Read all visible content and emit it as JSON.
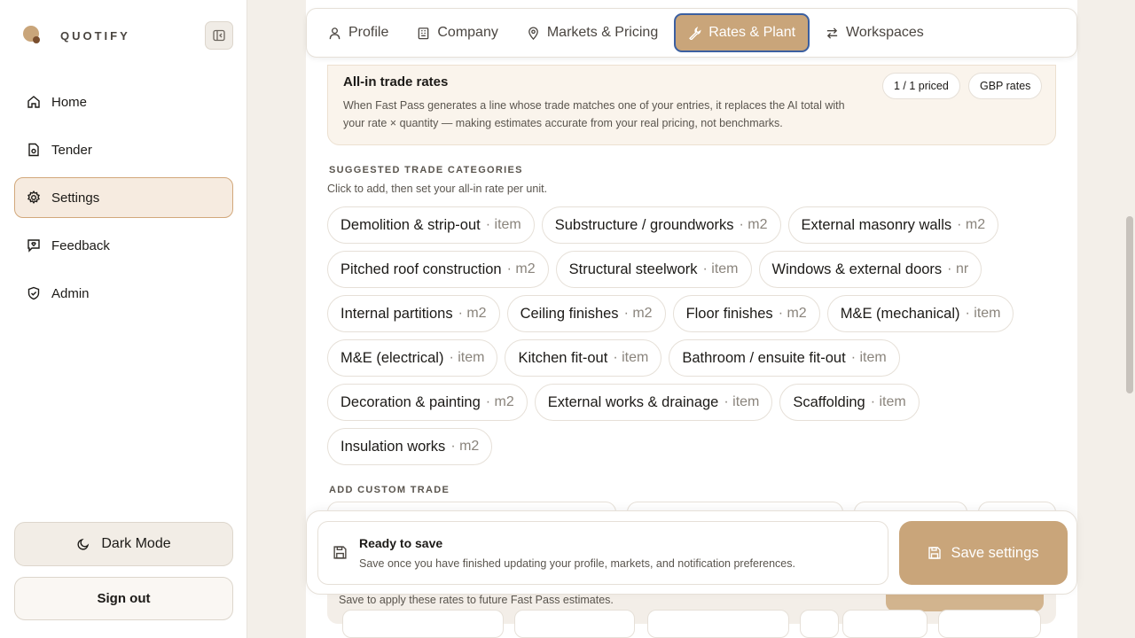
{
  "brand": {
    "name": "QUOTIFY"
  },
  "sidebar": {
    "items": [
      {
        "label": "Home",
        "icon": "home-icon"
      },
      {
        "label": "Tender",
        "icon": "document-icon"
      },
      {
        "label": "Settings",
        "icon": "gear-icon",
        "active": true
      },
      {
        "label": "Feedback",
        "icon": "message-icon"
      },
      {
        "label": "Admin",
        "icon": "shield-icon"
      }
    ],
    "dark_mode_label": "Dark Mode",
    "sign_out_label": "Sign out"
  },
  "tabs": [
    {
      "label": "Profile",
      "icon": "user-icon"
    },
    {
      "label": "Company",
      "icon": "building-icon"
    },
    {
      "label": "Markets & Pricing",
      "icon": "location-pin-icon"
    },
    {
      "label": "Rates & Plant",
      "icon": "wrench-icon",
      "active": true
    },
    {
      "label": "Workspaces",
      "icon": "swap-arrows-icon"
    }
  ],
  "rates": {
    "title": "All-in trade rates",
    "description": "When Fast Pass generates a line whose trade matches one of your entries, it replaces the AI total with your rate × quantity — making estimates accurate from your real pricing, not benchmarks.",
    "priced_badge": "1 / 1 priced",
    "currency_badge": "GBP rates"
  },
  "suggested": {
    "title": "SUGGESTED TRADE CATEGORIES",
    "hint": "Click to add, then set your all-in rate per unit.",
    "chips": [
      {
        "name": "Demolition & strip-out",
        "unit": "· item"
      },
      {
        "name": "Substructure / groundworks",
        "unit": "· m2"
      },
      {
        "name": "External masonry walls",
        "unit": "· m2"
      },
      {
        "name": "Pitched roof construction",
        "unit": "· m2"
      },
      {
        "name": "Structural steelwork",
        "unit": "· item"
      },
      {
        "name": "Windows & external doors",
        "unit": "· nr"
      },
      {
        "name": "Internal partitions",
        "unit": "· m2"
      },
      {
        "name": "Ceiling finishes",
        "unit": "· m2"
      },
      {
        "name": "Floor finishes",
        "unit": "· m2"
      },
      {
        "name": "M&E (mechanical)",
        "unit": "· item"
      },
      {
        "name": "M&E (electrical)",
        "unit": "· item"
      },
      {
        "name": "Kitchen fit-out",
        "unit": "· item"
      },
      {
        "name": "Bathroom / ensuite fit-out",
        "unit": "· item"
      },
      {
        "name": "Decoration & painting",
        "unit": "· m2"
      },
      {
        "name": "External works & drainage",
        "unit": "· item"
      },
      {
        "name": "Scaffolding",
        "unit": "· item"
      },
      {
        "name": "Insulation works",
        "unit": "· m2"
      }
    ]
  },
  "custom": {
    "title": "ADD CUSTOM TRADE",
    "apply_hint": "Save to apply these rates to future Fast Pass estimates."
  },
  "savebar": {
    "title": "Ready to save",
    "description": "Save once you have finished updating your profile, markets, and notification preferences.",
    "button": "Save settings"
  },
  "colors": {
    "accent": "#c9a57a",
    "focus_ring": "#3b5fa0",
    "active_nav_bg": "#f6ebe0"
  }
}
